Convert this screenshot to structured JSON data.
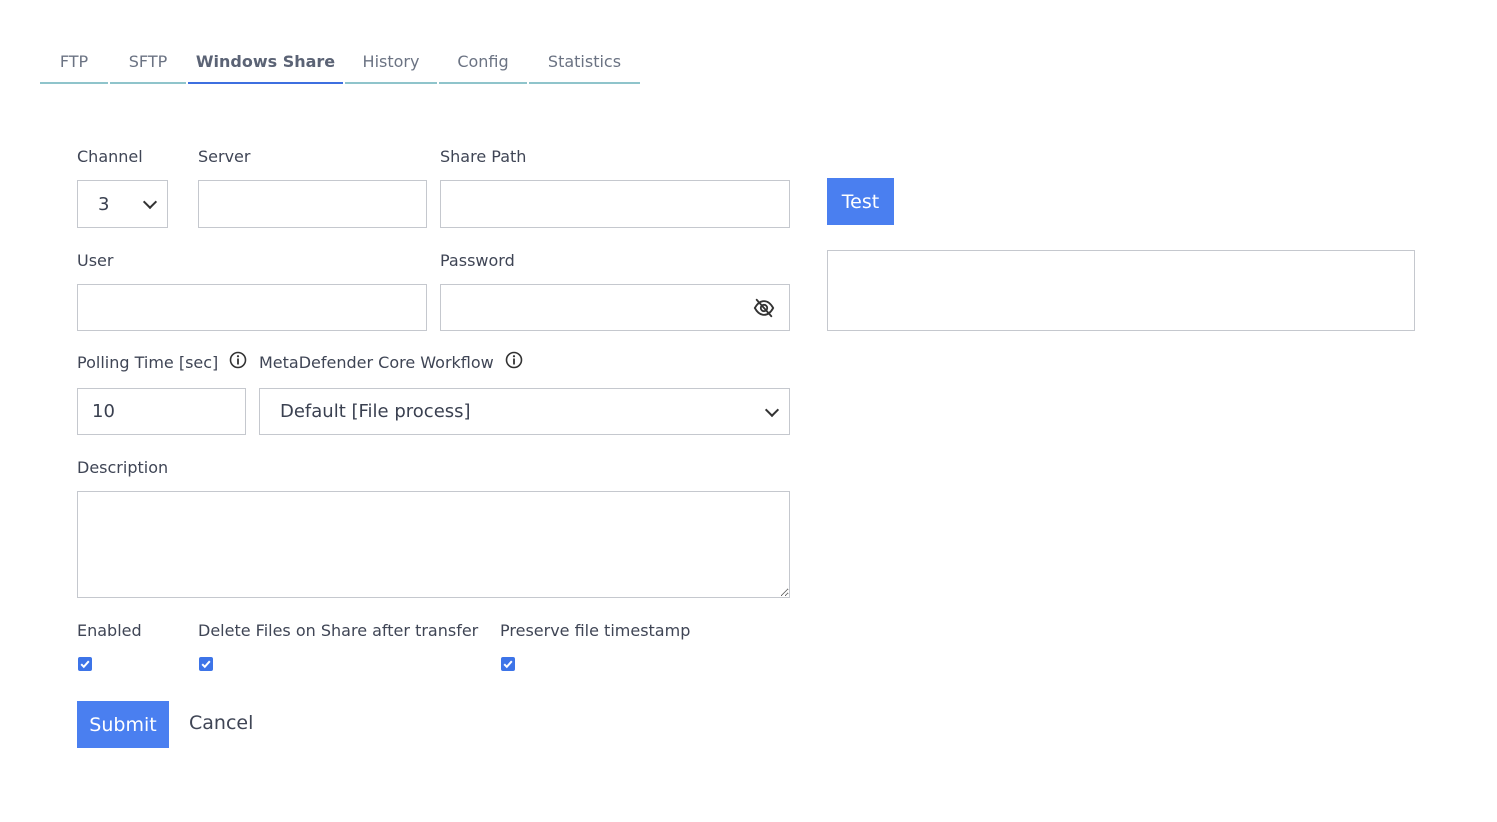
{
  "tabs": [
    {
      "label": "FTP"
    },
    {
      "label": "SFTP"
    },
    {
      "label": "Windows Share"
    },
    {
      "label": "History"
    },
    {
      "label": "Config"
    },
    {
      "label": "Statistics"
    }
  ],
  "active_tab": "Windows Share",
  "form": {
    "channel_label": "Channel",
    "channel_value": "3",
    "server_label": "Server",
    "server_value": "",
    "share_path_label": "Share Path",
    "share_path_value": "",
    "test_button": "Test",
    "test_result": "",
    "user_label": "User",
    "user_value": "",
    "password_label": "Password",
    "password_value": "",
    "polling_label": "Polling Time [sec]",
    "polling_value": "10",
    "workflow_label": "MetaDefender Core Workflow",
    "workflow_value": "Default [File process]",
    "description_label": "Description",
    "description_value": "",
    "enabled_label": "Enabled",
    "enabled_checked": true,
    "delete_label": "Delete Files on Share after transfer",
    "delete_checked": true,
    "preserve_label": "Preserve file timestamp",
    "preserve_checked": true,
    "submit_button": "Submit",
    "cancel_button": "Cancel"
  },
  "icons": {
    "password_toggle": "eye-slash-icon",
    "info": "info-circle-icon",
    "dropdown": "chevron-down-icon",
    "check": "checkmark-icon"
  },
  "colors": {
    "accent": "#4a7ff0",
    "tab_underline": "#8fc4cb",
    "tab_active_underline": "#3d6fe0"
  }
}
